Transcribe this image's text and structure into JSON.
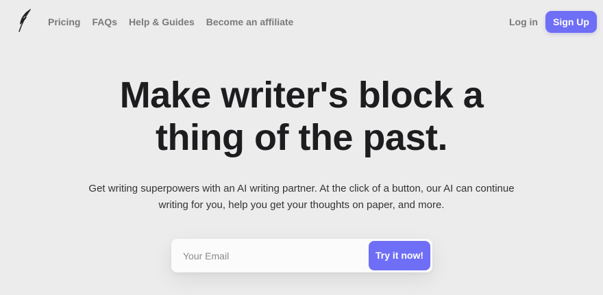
{
  "brand": {
    "logo_icon": "feather-quill-icon"
  },
  "nav": {
    "items": [
      {
        "label": "Pricing"
      },
      {
        "label": "FAQs"
      },
      {
        "label": "Help & Guides"
      },
      {
        "label": "Become an affiliate"
      }
    ],
    "login_label": "Log in",
    "signup_label": "Sign Up"
  },
  "hero": {
    "title_line1": "Make writer's block a",
    "title_line2": "thing of the past.",
    "subtitle_line1": "Get writing superpowers with an AI writing partner. At the click of a button, our AI can continue",
    "subtitle_line2": "writing for you, help you get your thoughts on paper, and more."
  },
  "signup_form": {
    "email_placeholder": "Your Email",
    "email_value": "",
    "submit_label": "Try it now!"
  },
  "colors": {
    "background": "#ececec",
    "accent": "#6e6ef6",
    "heading": "#1d1d1f",
    "nav_text": "#7a7a7a"
  }
}
